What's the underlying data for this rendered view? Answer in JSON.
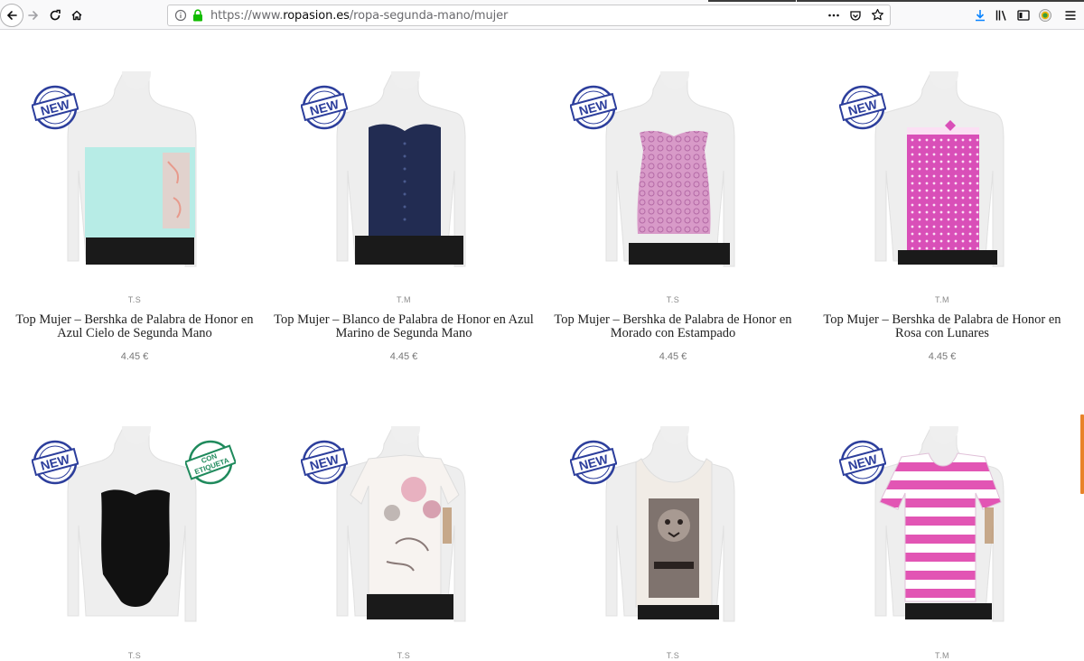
{
  "browser": {
    "url_prefix": "https://www.",
    "url_host": "ropasion.es",
    "url_path": "/ropa-segunda-mano/mujer"
  },
  "colors": {
    "stamp_blue": "#2c3e9c",
    "stamp_green": "#1f8a5c",
    "scroll_accent": "#e8832a",
    "download_blue": "#0a84ff"
  },
  "products": [
    {
      "size": "T.S",
      "title": "Top Mujer – Bershka de Palabra de Honor en Azul Cielo de Segunda Mano",
      "price": "4.45 €",
      "badge": "NEW",
      "garment": "strapless-light-blue"
    },
    {
      "size": "T.M",
      "title": "Top Mujer – Blanco de Palabra de Honor en Azul Marino de Segunda Mano",
      "price": "4.45 €",
      "badge": "NEW",
      "garment": "strapless-navy"
    },
    {
      "size": "T.S",
      "title": "Top Mujer – Bershka de Palabra de Honor en Morado con Estampado",
      "price": "4.45 €",
      "badge": "NEW",
      "garment": "strapless-purple-pattern"
    },
    {
      "size": "T.M",
      "title": "Top Mujer – Bershka de Palabra de Honor en Rosa con Lunares",
      "price": "4.45 €",
      "badge": "NEW",
      "garment": "strapless-pink-dots"
    },
    {
      "size": "T.S",
      "title": "",
      "price": "",
      "badge": "NEW",
      "badge2": "CON ETIQUETA",
      "garment": "black-bodysuit"
    },
    {
      "size": "T.S",
      "title": "",
      "price": "",
      "badge": "NEW",
      "garment": "white-floral-tee"
    },
    {
      "size": "T.S",
      "title": "",
      "price": "",
      "badge": "NEW",
      "garment": "leopard-print-tank"
    },
    {
      "size": "T.M",
      "title": "",
      "price": "",
      "badge": "NEW",
      "garment": "pink-stripe-tee"
    }
  ]
}
